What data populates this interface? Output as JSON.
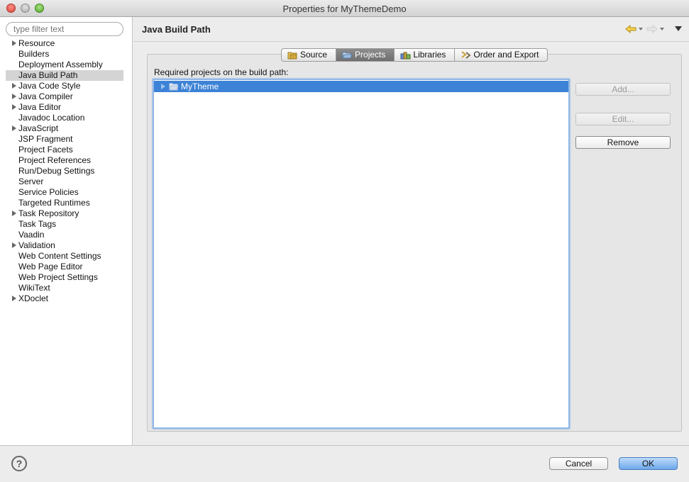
{
  "window": {
    "title": "Properties for MyThemeDemo"
  },
  "sidebar": {
    "filter_placeholder": "type filter text",
    "items": [
      {
        "label": "Resource",
        "expandable": true
      },
      {
        "label": "Builders",
        "expandable": false
      },
      {
        "label": "Deployment Assembly",
        "expandable": false
      },
      {
        "label": "Java Build Path",
        "expandable": false,
        "selected": true
      },
      {
        "label": "Java Code Style",
        "expandable": true
      },
      {
        "label": "Java Compiler",
        "expandable": true
      },
      {
        "label": "Java Editor",
        "expandable": true
      },
      {
        "label": "Javadoc Location",
        "expandable": false
      },
      {
        "label": "JavaScript",
        "expandable": true
      },
      {
        "label": "JSP Fragment",
        "expandable": false
      },
      {
        "label": "Project Facets",
        "expandable": false
      },
      {
        "label": "Project References",
        "expandable": false
      },
      {
        "label": "Run/Debug Settings",
        "expandable": false
      },
      {
        "label": "Server",
        "expandable": false
      },
      {
        "label": "Service Policies",
        "expandable": false
      },
      {
        "label": "Targeted Runtimes",
        "expandable": false
      },
      {
        "label": "Task Repository",
        "expandable": true
      },
      {
        "label": "Task Tags",
        "expandable": false
      },
      {
        "label": "Vaadin",
        "expandable": false
      },
      {
        "label": "Validation",
        "expandable": true
      },
      {
        "label": "Web Content Settings",
        "expandable": false
      },
      {
        "label": "Web Page Editor",
        "expandable": false
      },
      {
        "label": "Web Project Settings",
        "expandable": false
      },
      {
        "label": "WikiText",
        "expandable": false
      },
      {
        "label": "XDoclet",
        "expandable": true
      }
    ]
  },
  "main": {
    "title": "Java Build Path",
    "tabs": [
      {
        "label": "Source",
        "icon": "source-folder-icon"
      },
      {
        "label": "Projects",
        "icon": "projects-icon",
        "active": true
      },
      {
        "label": "Libraries",
        "icon": "libraries-icon"
      },
      {
        "label": "Order and Export",
        "icon": "order-export-icon"
      }
    ],
    "list_label": "Required projects on the build path:",
    "projects": [
      {
        "label": "MyTheme",
        "selected": true
      }
    ],
    "buttons": {
      "add": "Add...",
      "edit": "Edit...",
      "remove": "Remove"
    }
  },
  "footer": {
    "help": "?",
    "cancel": "Cancel",
    "ok": "OK"
  },
  "colors": {
    "selection": "#3c82d6",
    "default_button": "#6da7ea"
  }
}
